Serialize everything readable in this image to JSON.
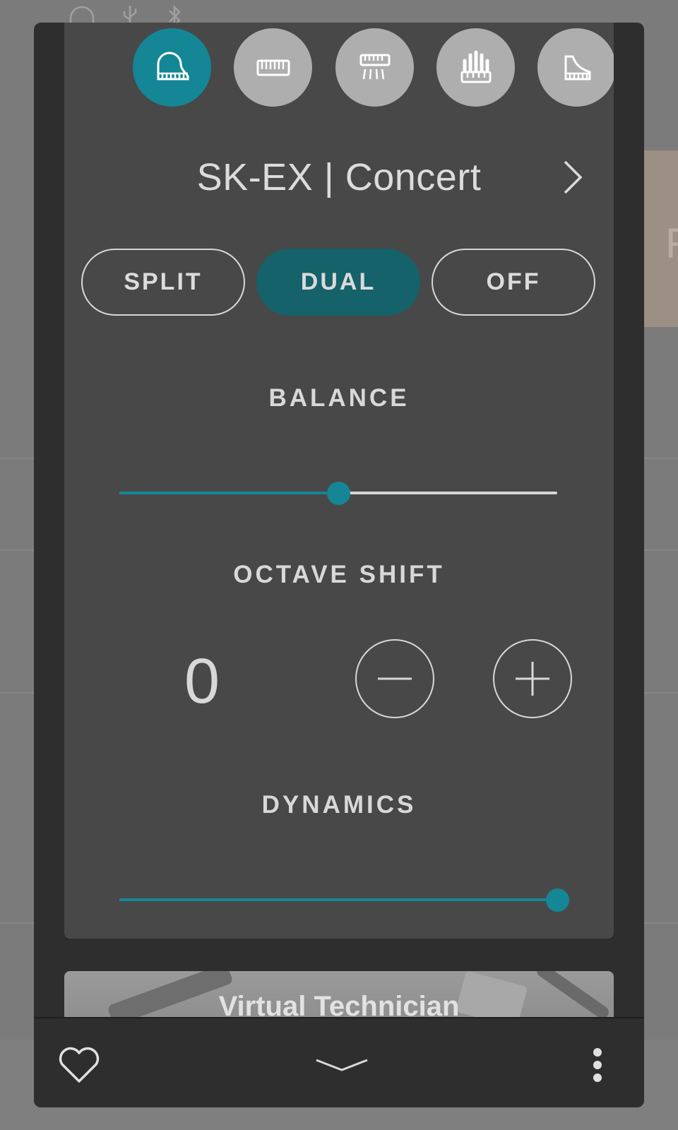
{
  "status_bar": {
    "icons": [
      "headphones-icon",
      "usb-icon",
      "bluetooth-icon"
    ]
  },
  "background": {
    "card_letter": "F"
  },
  "sound_categories": [
    {
      "icon": "grand-piano-icon",
      "active": true
    },
    {
      "icon": "electric-piano-icon",
      "active": false
    },
    {
      "icon": "harpsichord-icon",
      "active": false
    },
    {
      "icon": "organ-icon",
      "active": false
    },
    {
      "icon": "grand-piano-outline-icon",
      "active": false
    },
    {
      "icon": "more-sound-icon",
      "active": false
    }
  ],
  "sound": {
    "title": "SK-EX | Concert"
  },
  "modes": [
    {
      "label": "SPLIT",
      "active": false
    },
    {
      "label": "DUAL",
      "active": true
    },
    {
      "label": "OFF",
      "active": false
    }
  ],
  "balance": {
    "label": "BALANCE",
    "value_fraction": 0.5
  },
  "octave_shift": {
    "label": "OCTAVE SHIFT",
    "value": "0"
  },
  "dynamics": {
    "label": "DYNAMICS",
    "value_fraction": 1.0
  },
  "virtual_technician": {
    "title": "Virtual Technician"
  },
  "bottom_bar": {
    "icons": [
      "heart-icon",
      "chevron-down-icon",
      "more-vertical-icon"
    ]
  },
  "colors": {
    "accent": "#158696",
    "accent_dark": "#15626a",
    "panel": "#484848",
    "modal": "#2e2e2e"
  }
}
